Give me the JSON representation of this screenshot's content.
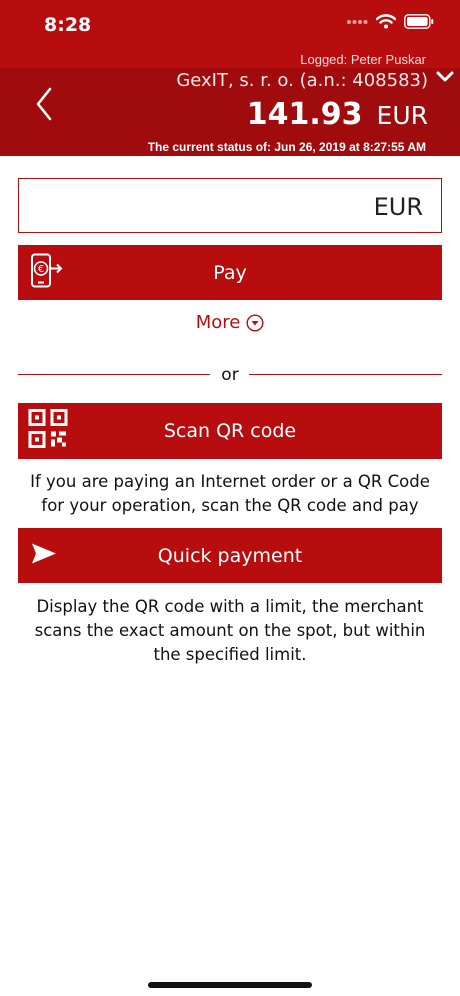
{
  "status_bar": {
    "time": "8:28",
    "icons": [
      "signal-dots-icon",
      "wifi-icon",
      "battery-icon"
    ]
  },
  "header": {
    "logged": "Logged: Peter Puskar",
    "company": "GexIT, s. r. o.  (a.n.: 408583)",
    "balance_amount": "141.93",
    "balance_currency": "EUR",
    "status_line": "The current status of: Jun 26, 2019 at 8:27:55 AM"
  },
  "amount_field": {
    "value": "",
    "placeholder": "",
    "currency": "EUR"
  },
  "actions": {
    "pay_label": "Pay",
    "more_label": "More",
    "or_label": "or",
    "scan_label": "Scan QR code",
    "scan_info": "If you are paying an Internet order or a QR Code for your operation, scan the QR code and pay",
    "quick_label": "Quick payment",
    "quick_info": "Display the QR code with a limit, the merchant scans the exact amount on the spot, but within the specified limit."
  },
  "colors": {
    "brand": "#b70d0f",
    "header_band": "#a00b0d"
  }
}
